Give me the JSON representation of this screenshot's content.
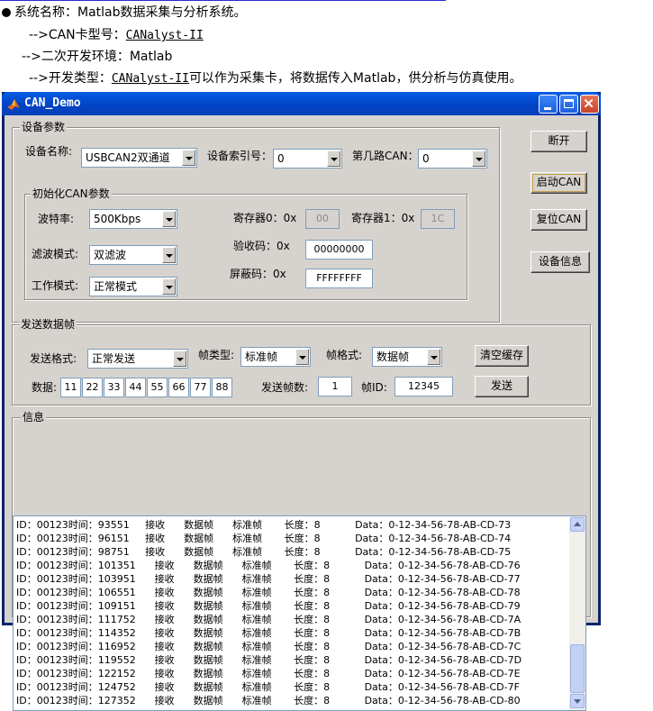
{
  "header": {
    "line1": "系统名称：Matlab数据采集与分析系统。",
    "line2_prefix": "-->CAN卡型号：",
    "line2_link": "CANalyst-II",
    "line3": "-->二次开发环境：Matlab",
    "line4_prefix": "-->开发类型：",
    "line4_link": "CANalyst-II",
    "line4_rest": "可以作为采集卡，将数据传入Matlab，供分析与仿真使用。"
  },
  "window": {
    "title": "CAN_Demo"
  },
  "device_params": {
    "group_label": "设备参数",
    "device_name_label": "设备名称:",
    "device_name_value": "USBCAN2双通道",
    "device_index_label": "设备索引号：",
    "device_index_value": "0",
    "can_channel_label": "第几路CAN：",
    "can_channel_value": "0"
  },
  "init_params": {
    "group_label": "初始化CAN参数",
    "baud_label": "波特率:",
    "baud_value": "500Kbps",
    "filter_label": "滤波模式:",
    "filter_value": "双滤波",
    "mode_label": "工作模式:",
    "mode_value": "正常模式",
    "reg0_label": "寄存器0：0x",
    "reg0_value": "00",
    "reg1_label": "寄存器1：0x",
    "reg1_value": "1C",
    "acc_code_label": "验收码：0x",
    "acc_code_value": "00000000",
    "mask_label": "屏蔽码：0x",
    "mask_value": "FFFFFFFF"
  },
  "buttons": {
    "disconnect": "断开",
    "start_can": "启动CAN",
    "reset_can": "复位CAN",
    "device_info": "设备信息",
    "clear_buffer": "清空缓存",
    "send": "发送"
  },
  "send_frame": {
    "group_label": "发送数据帧",
    "send_format_label": "发送格式:",
    "send_format_value": "正常发送",
    "frame_type_label": "帧类型:",
    "frame_type_value": "标准帧",
    "frame_format_label": "帧格式:",
    "frame_format_value": "数据帧",
    "data_label": "数据:",
    "data_bytes": [
      "11",
      "22",
      "33",
      "44",
      "55",
      "66",
      "77",
      "88"
    ],
    "send_count_label": "发送帧数:",
    "send_count_value": "1",
    "frame_id_label": "帧ID:",
    "frame_id_value": "12345"
  },
  "info": {
    "group_label": "信息",
    "lines": [
      "ID：00123时间：93551     接收      数据帧      标准帧       长度：8           Data：0-12-34-56-78-AB-CD-73",
      "ID：00123时间：96151     接收      数据帧      标准帧       长度：8           Data：0-12-34-56-78-AB-CD-74",
      "ID：00123时间：98751     接收      数据帧      标准帧       长度：8           Data：0-12-34-56-78-AB-CD-75",
      "ID：00123时间：101351      接收      数据帧      标准帧       长度：8           Data：0-12-34-56-78-AB-CD-76",
      "ID：00123时间：103951      接收      数据帧      标准帧       长度：8           Data：0-12-34-56-78-AB-CD-77",
      "ID：00123时间：106551      接收      数据帧      标准帧       长度：8           Data：0-12-34-56-78-AB-CD-78",
      "ID：00123时间：109151      接收      数据帧      标准帧       长度：8           Data：0-12-34-56-78-AB-CD-79",
      "ID：00123时间：111752      接收      数据帧      标准帧       长度：8           Data：0-12-34-56-78-AB-CD-7A",
      "ID：00123时间：114352      接收      数据帧      标准帧       长度：8           Data：0-12-34-56-78-AB-CD-7B",
      "ID：00123时间：116952      接收      数据帧      标准帧       长度：8           Data：0-12-34-56-78-AB-CD-7C",
      "ID：00123时间：119552      接收      数据帧      标准帧       长度：8           Data：0-12-34-56-78-AB-CD-7D",
      "ID：00123时间：122152      接收      数据帧      标准帧       长度：8           Data：0-12-34-56-78-AB-CD-7E",
      "ID：00123时间：124752      接收      数据帧      标准帧       长度：8           Data：0-12-34-56-78-AB-CD-7F",
      "ID：00123时间：127352      接收      数据帧      标准帧       长度：8           Data：0-12-34-56-78-AB-CD-80"
    ]
  },
  "colors": {
    "titlebar": "#0143c4",
    "window_bg": "#d6d3ce",
    "focus_ring": "#c8a34a"
  }
}
